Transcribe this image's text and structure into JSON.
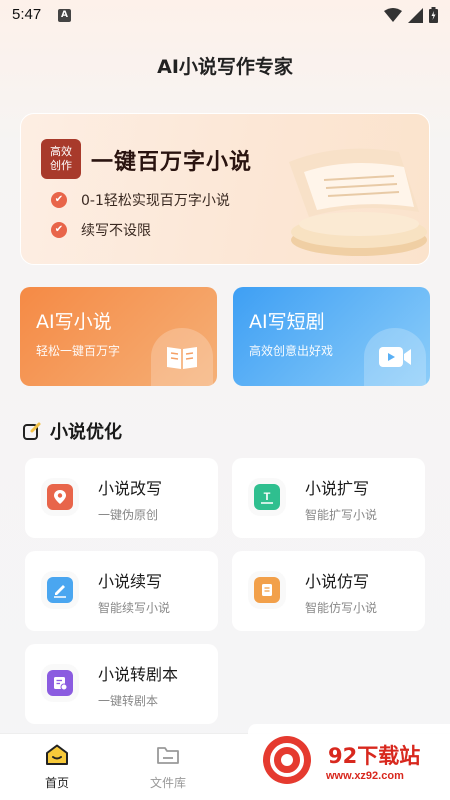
{
  "status_bar": {
    "time": "5:47",
    "notification_letter": "A"
  },
  "app": {
    "title": "AI小说写作专家"
  },
  "banner": {
    "badge_line1": "高效",
    "badge_line2": "创作",
    "title": "一键百万字小说",
    "features": [
      "0-1轻松实现百万字小说",
      "续写不设限"
    ],
    "check_color": "#e8654a"
  },
  "feature_cards": [
    {
      "title": "AI写小说",
      "subtitle": "轻松一键百万字",
      "icon": "book-icon",
      "color": "#f58a45"
    },
    {
      "title": "AI写短剧",
      "subtitle": "高效创意出好戏",
      "icon": "video-icon",
      "color": "#3e9ff4"
    }
  ],
  "section": {
    "title": "小说优化"
  },
  "tools": [
    {
      "name": "小说改写",
      "desc": "一键伪原创",
      "icon": "location-pin-icon",
      "color": "#e8654a"
    },
    {
      "name": "小说扩写",
      "desc": "智能扩写小说",
      "icon": "text-expand-icon",
      "color": "#2fbf8f"
    },
    {
      "name": "小说续写",
      "desc": "智能续写小说",
      "icon": "pen-icon",
      "color": "#4aa6f0"
    },
    {
      "name": "小说仿写",
      "desc": "智能仿写小说",
      "icon": "scroll-icon",
      "color": "#f2a04a"
    },
    {
      "name": "小说转剧本",
      "desc": "一键转剧本",
      "icon": "script-icon",
      "color": "#8b5ce0"
    }
  ],
  "bottom_nav": [
    {
      "label": "首页",
      "icon": "home-icon",
      "active": true
    },
    {
      "label": "文件库",
      "icon": "folder-icon",
      "active": false
    }
  ],
  "watermark": {
    "title": "92下载站",
    "url": "www.xz92.com"
  }
}
